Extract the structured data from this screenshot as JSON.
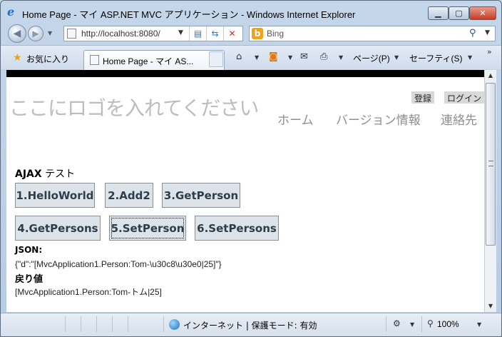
{
  "window": {
    "title": "Home Page - マイ ASP.NET MVC アプリケーション - Windows Internet Explorer",
    "min_glyph": "▁",
    "max_glyph": "▢",
    "close_glyph": "✕"
  },
  "address_bar": {
    "url": "http://localhost:8080/",
    "search_placeholder": "Bing",
    "bing_glyph": "b"
  },
  "favorites": {
    "label": "お気に入り"
  },
  "tabs": [
    {
      "label": "Home Page - マイ AS..."
    }
  ],
  "command_bar": {
    "page_label": "ページ(P)",
    "safety_label": "セーフティ(S)",
    "more_glyph": "»"
  },
  "site": {
    "logo_text": "ここにロゴを入れてください",
    "register_link": "登録",
    "login_link": "ログイン",
    "menu": [
      {
        "label": "ホーム"
      },
      {
        "label": "バージョン情報"
      },
      {
        "label": "連絡先"
      }
    ]
  },
  "ajax": {
    "title_bold": "AJAX",
    "title_rest": " テスト",
    "buttons": [
      {
        "label": "1.HelloWorld"
      },
      {
        "label": "2.Add2"
      },
      {
        "label": "3.GetPerson"
      },
      {
        "label": "4.GetPersons"
      },
      {
        "label": "5.SetPerson"
      },
      {
        "label": "6.SetPersons"
      }
    ],
    "json_label": "JSON:",
    "json_value": "{\"d\":\"[MvcApplication1.Person:Tom-\\u30c8\\u30e0|25]\"}",
    "result_label": "戻り値",
    "result_value": "[MvcApplication1.Person:Tom-トム|25]"
  },
  "status_bar": {
    "zone_text": "インターネット | 保護モード: 有効",
    "zoom": "100%"
  }
}
